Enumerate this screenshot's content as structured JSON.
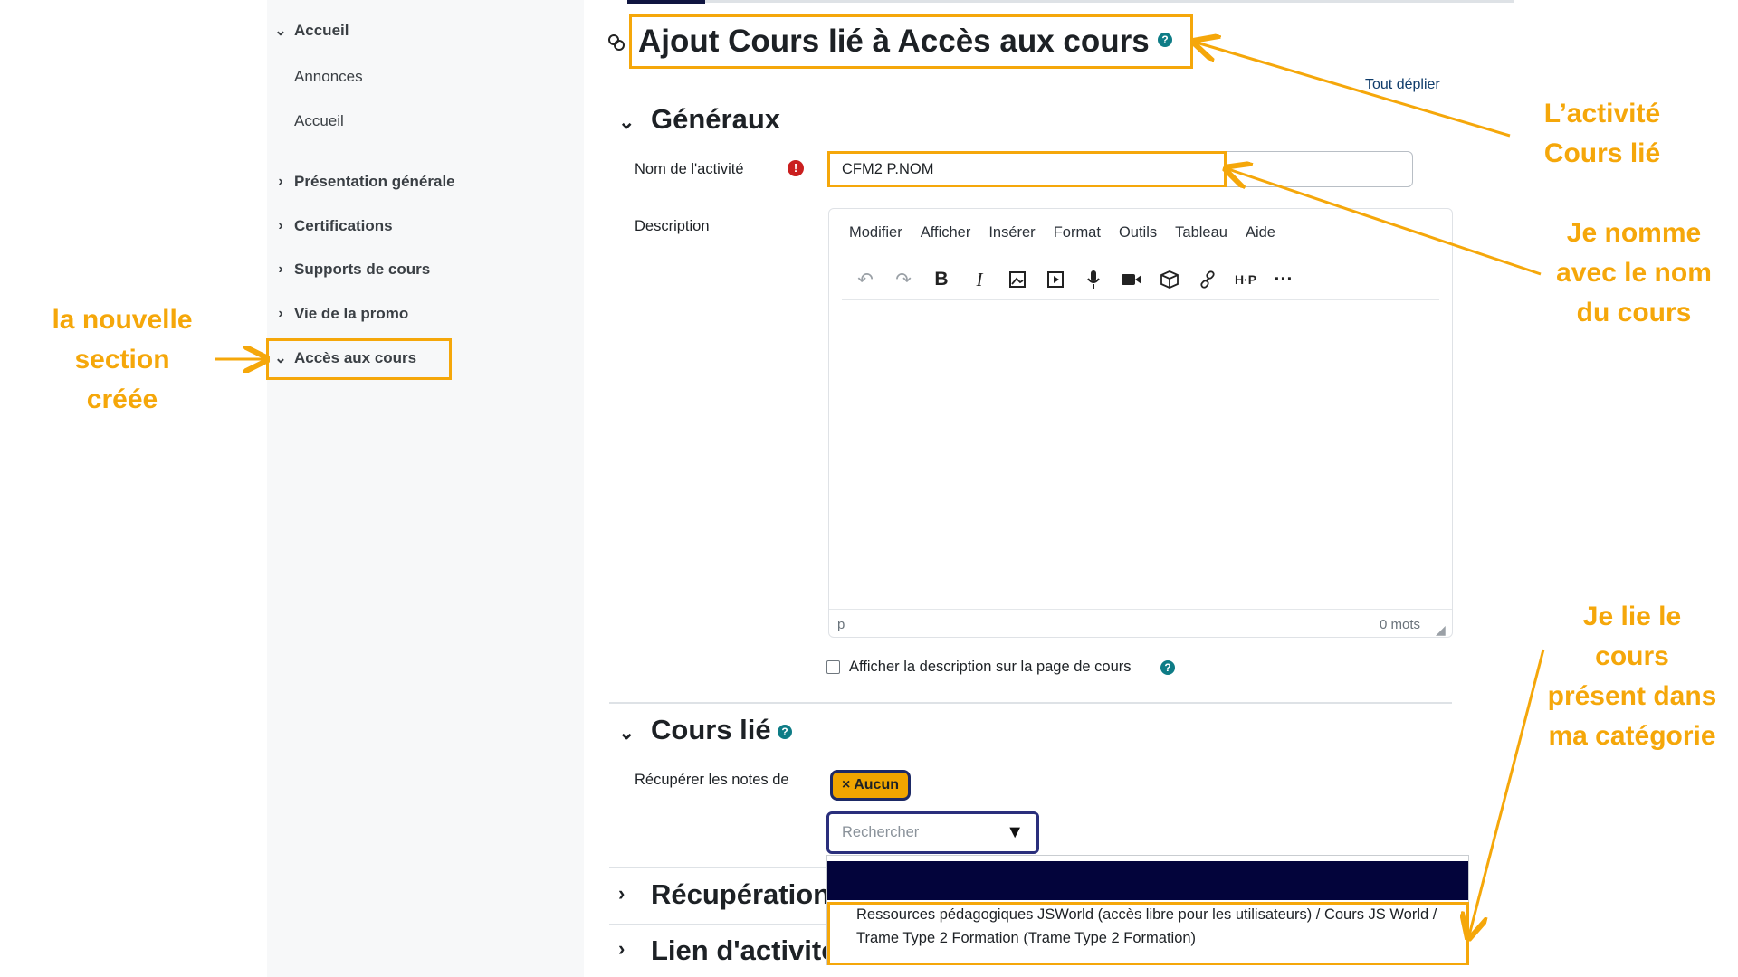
{
  "sidebar": {
    "items": [
      {
        "label": "Accueil",
        "expanded": true
      },
      {
        "label": "Annonces",
        "sub": true
      },
      {
        "label": "Accueil",
        "sub": true
      },
      {
        "label": "Présentation générale",
        "expanded": false
      },
      {
        "label": "Certifications",
        "expanded": false
      },
      {
        "label": "Supports de cours",
        "expanded": false
      },
      {
        "label": "Vie de la promo",
        "expanded": false
      },
      {
        "label": "Accès aux cours",
        "expanded": true
      }
    ]
  },
  "header": {
    "title": "Ajout Cours lié à Accès aux cours",
    "expand_all": "Tout déplier"
  },
  "general": {
    "title": "Généraux",
    "name_label": "Nom de l'activité",
    "name_value": "CFM2 P.NOM",
    "description_label": "Description",
    "menu": [
      "Modifier",
      "Afficher",
      "Insérer",
      "Format",
      "Outils",
      "Tableau",
      "Aide"
    ],
    "status_path": "p",
    "word_count": "0 mots",
    "show_description_label": "Afficher la description sur la page de cours"
  },
  "linked_course": {
    "title": "Cours lié",
    "grades_label": "Récupérer les notes de",
    "selected_tag": "× Aucun",
    "search_placeholder": "Rechercher",
    "option": "Ressources pédagogiques JSWorld (accès libre pour les utilisateurs) / Cours JS World / Trame Type 2 Formation (Trame Type 2 Formation)"
  },
  "collapsed_sections": [
    "Récupération",
    "Lien d'activité"
  ],
  "annotations": {
    "new_section": "la nouvelle section créée",
    "activity": "L’activité Cours lié",
    "name_note": "Je nomme avec le nom du cours",
    "link_note": "Je lie le cours présent dans ma catégorie"
  },
  "colors": {
    "annotation": "#f5a70a",
    "tag": "#f0a500",
    "focus": "#2a2f7c",
    "highlight": "#03043b"
  }
}
